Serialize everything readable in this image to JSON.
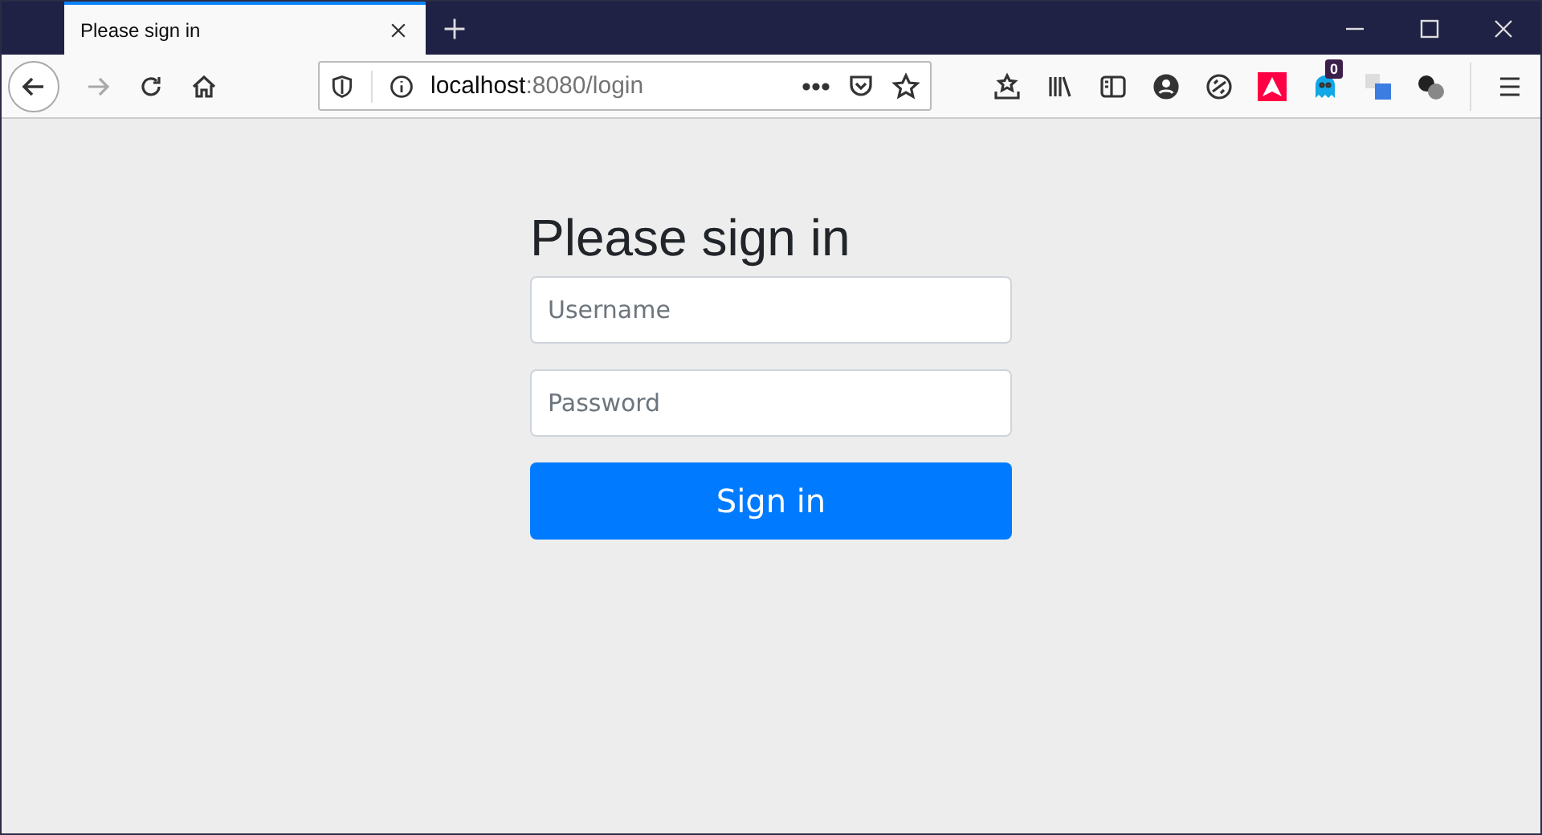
{
  "tab": {
    "title": "Please sign in",
    "selected": true
  },
  "address_bar": {
    "host": "localhost",
    "path": ":8080/login"
  },
  "extension_badge": "0",
  "login": {
    "heading": "Please sign in",
    "username": {
      "placeholder": "Username"
    },
    "password": {
      "placeholder": "Password"
    },
    "button": "Sign in"
  }
}
